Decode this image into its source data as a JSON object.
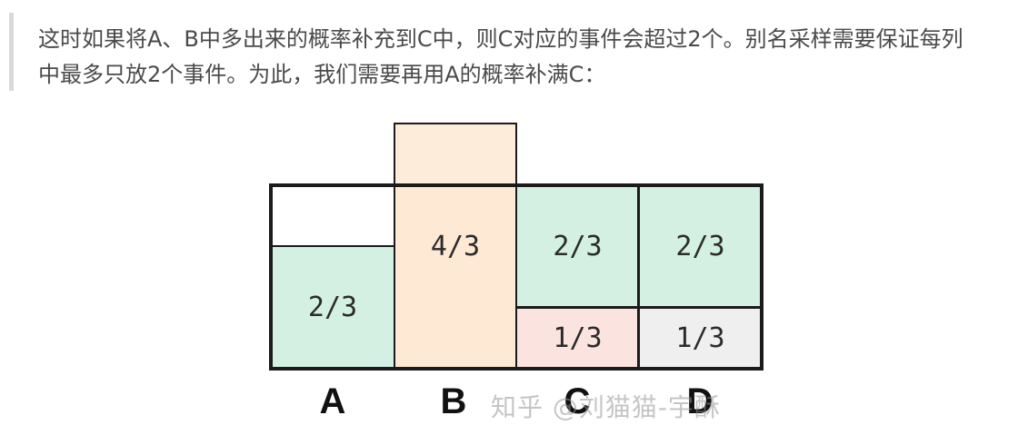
{
  "quote": {
    "line1": "这时如果将A、B中多出来的概率补充到C中，则C对应的事件会超过2个。别名采样需要保证每列",
    "line2": "中最多只放2个事件。为此，我们需要再用A的概率补满C："
  },
  "figure": {
    "cells": {
      "a_bottom": "2/3",
      "b_main": "4/3",
      "c_top": "2/3",
      "c_bottom": "1/3",
      "d_top": "2/3",
      "d_bottom": "1/3"
    },
    "labels": {
      "a": "A",
      "b": "B",
      "c": "C",
      "d": "D"
    },
    "watermark": "知乎 @刘猫猫-宇酥",
    "colors": {
      "green": "#d3f0e3",
      "peach": "#fde9d4",
      "pink": "#fbe3df",
      "gray": "#efefef",
      "border": "#1b1b1b"
    }
  }
}
